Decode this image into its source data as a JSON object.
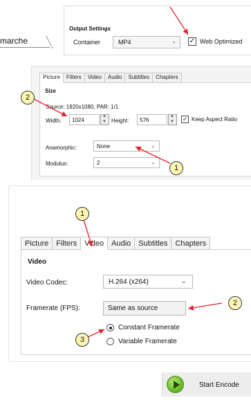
{
  "section1": {
    "tab_label": "marche",
    "title": "Output Settings",
    "container_label": "Container",
    "container_value": "MP4",
    "web_optimized_label": "Web Optimized",
    "web_optimized_checked": true
  },
  "section2": {
    "tabs": [
      "Picture",
      "Filters",
      "Video",
      "Audio",
      "Subtitles",
      "Chapters"
    ],
    "active_tab": "Picture",
    "size_heading": "Size",
    "source_text": "Source:  1920x1080, PAR: 1/1",
    "width_label": "Width:",
    "width_value": "1024",
    "height_label": "Height:",
    "height_value": "576",
    "keep_aspect_label": "Keep Aspect Ratio",
    "keep_aspect_checked": true,
    "anamorphic_label": "Anamorphic:",
    "anamorphic_value": "None",
    "modulus_label": "Modulus:",
    "modulus_value": "2",
    "callouts": [
      "2",
      "1"
    ]
  },
  "section3": {
    "tabs": [
      "Picture",
      "Filters",
      "Video",
      "Audio",
      "Subtitles",
      "Chapters"
    ],
    "active_tab": "Video",
    "heading": "Video",
    "codec_label": "Video Codec:",
    "codec_value": "H.264 (x264)",
    "framerate_label": "Framerate (FPS):",
    "framerate_value": "Same as source",
    "radio_constant_label": "Constant Framerate",
    "radio_variable_label": "Variable Framerate",
    "selected_radio": "Constant Framerate",
    "callouts": [
      "1",
      "2",
      "3"
    ]
  },
  "section4": {
    "start_label": "Start Encode"
  },
  "colors": {
    "arrow": "#e8212b",
    "callout_fill": "#fdf6b3",
    "play_green": "#6fbf2f"
  },
  "icons": {
    "dropdown": "chevron-down-icon",
    "spinner": "spinner-arrows-icon",
    "start": "play-icon"
  }
}
